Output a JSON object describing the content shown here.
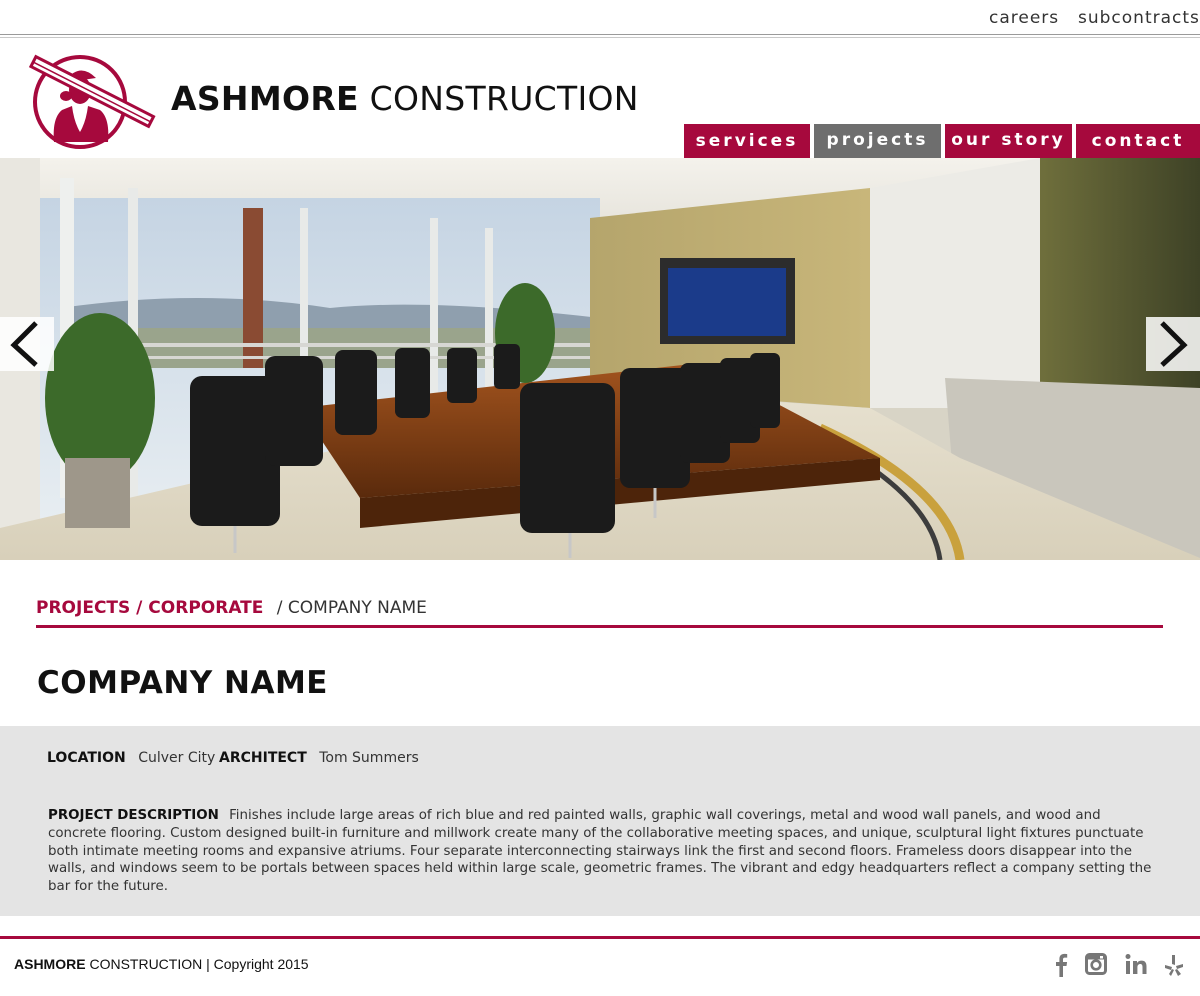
{
  "util_nav": {
    "careers": "careers",
    "subcontracts": "subcontracts"
  },
  "logo": {
    "bold": "ASHMORE",
    "light": "CONSTRUCTION",
    "mark_icon": "worker-carrying-beam-icon"
  },
  "main_nav": [
    {
      "label": "services",
      "active": false
    },
    {
      "label": "projects",
      "active": true
    },
    {
      "label": "our story",
      "active": false
    },
    {
      "label": "contact",
      "active": false
    }
  ],
  "hero": {
    "prev_icon": "chevron-left-icon",
    "next_icon": "chevron-right-icon",
    "image_subject": "conference-room-photo"
  },
  "breadcrumb": {
    "section": "PROJECTS / CORPORATE",
    "separator": "/",
    "current": "COMPANY NAME"
  },
  "project": {
    "title": "COMPANY NAME",
    "location_label": "LOCATION",
    "location_value": "Culver City",
    "architect_label": "ARCHITECT",
    "architect_value": "Tom Summers",
    "description_label": "PROJECT DESCRIPTION",
    "description": "Finishes include large areas of rich blue and red painted walls, graphic wall coverings, metal and wood wall panels, and wood and concrete flooring. Custom designed built-in furniture and millwork create many of the collaborative meeting spaces, and unique, sculptural light fixtures punctuate both intimate meeting rooms and expansive atriums.  Four separate interconnecting stairways link the first and second floors.  Frameless doors disappear into the walls, and windows seem to be portals between spaces held within large scale, geometric frames.  The vibrant and edgy headquarters reflect a company setting the bar for the future."
  },
  "footer": {
    "brand_bold": "ASHMORE",
    "brand_rest": " CONSTRUCTION | Copyright 2015",
    "social": [
      "facebook-icon",
      "instagram-icon",
      "linkedin-icon",
      "yelp-icon"
    ]
  },
  "colors": {
    "brand_red": "#a6093d",
    "active_gray": "#6e6e6e",
    "panel_gray": "#e4e4e4"
  }
}
